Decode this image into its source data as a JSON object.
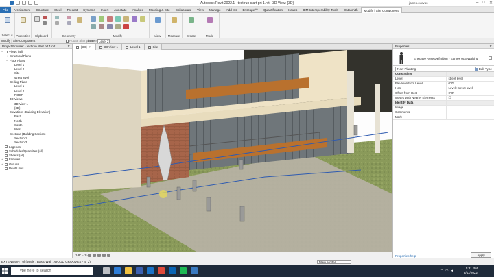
{
  "window": {
    "title": "Autodesk Revit 2022.1 - test run start prt 1.rvt - 3D View: {3D}",
    "user": "james.cuevas",
    "controls": [
      "–",
      "□",
      "✕"
    ]
  },
  "ribbon_tabs": [
    "File",
    "Architecture",
    "Structure",
    "Steel",
    "Precast",
    "Systems",
    "Insert",
    "Annotate",
    "Analyze",
    "Massing & Site",
    "Collaborate",
    "View",
    "Manage",
    "Add-Ins",
    "Enscape™",
    "Quantification",
    "Issues",
    "BIM Interoperability Tools",
    "Datasmith",
    "Modify | Site Component"
  ],
  "ribbon_groups": [
    "Select ▾",
    "Properties",
    "Clipboard",
    "Geometry",
    "Modify",
    "View",
    "Measure",
    "Create",
    "Mode"
  ],
  "options_bar": {
    "context": "Modify | Site Component",
    "rotate_label": "Rotate after placement",
    "level_label": "Level",
    "level_value": "Level 2"
  },
  "project_browser": {
    "header": "Project Browser - test run start prt 1.rvt",
    "close": "✕",
    "items": [
      {
        "label": "Views (all)",
        "toggle": "−",
        "indent": 0,
        "box": true
      },
      {
        "label": "Structural Plans",
        "toggle": "+",
        "indent": 1,
        "box": false
      },
      {
        "label": "Floor Plans",
        "toggle": "−",
        "indent": 1,
        "box": false
      },
      {
        "label": "Level 1",
        "toggle": "",
        "indent": 2,
        "box": false
      },
      {
        "label": "Level 2",
        "toggle": "",
        "indent": 2,
        "box": false
      },
      {
        "label": "Site",
        "toggle": "",
        "indent": 2,
        "box": false
      },
      {
        "label": "street level",
        "toggle": "",
        "indent": 2,
        "box": false
      },
      {
        "label": "Ceiling Plans",
        "toggle": "−",
        "indent": 1,
        "box": false
      },
      {
        "label": "Level 1",
        "toggle": "",
        "indent": 2,
        "box": false
      },
      {
        "label": "Level 2",
        "toggle": "",
        "indent": 2,
        "box": false
      },
      {
        "label": "ROOF",
        "toggle": "",
        "indent": 2,
        "box": false
      },
      {
        "label": "3D Views",
        "toggle": "−",
        "indent": 1,
        "box": false
      },
      {
        "label": "3D View 1",
        "toggle": "",
        "indent": 2,
        "box": false
      },
      {
        "label": "{3D}",
        "toggle": "",
        "indent": 2,
        "box": false
      },
      {
        "label": "Elevations (Building Elevation)",
        "toggle": "−",
        "indent": 1,
        "box": false
      },
      {
        "label": "East",
        "toggle": "",
        "indent": 2,
        "box": false
      },
      {
        "label": "North",
        "toggle": "",
        "indent": 2,
        "box": false
      },
      {
        "label": "South",
        "toggle": "",
        "indent": 2,
        "box": false
      },
      {
        "label": "West",
        "toggle": "",
        "indent": 2,
        "box": false
      },
      {
        "label": "Sections (Building Section)",
        "toggle": "−",
        "indent": 1,
        "box": false
      },
      {
        "label": "Section 1",
        "toggle": "",
        "indent": 2,
        "box": false
      },
      {
        "label": "Section 2",
        "toggle": "",
        "indent": 2,
        "box": false
      },
      {
        "label": "Legends",
        "toggle": "",
        "indent": 0,
        "box": true
      },
      {
        "label": "Schedules/Quantities (all)",
        "toggle": "",
        "indent": 0,
        "box": true
      },
      {
        "label": "Sheets (all)",
        "toggle": "",
        "indent": 0,
        "box": true
      },
      {
        "label": "Families",
        "toggle": "+",
        "indent": 0,
        "box": true
      },
      {
        "label": "Groups",
        "toggle": "+",
        "indent": 0,
        "box": true
      },
      {
        "label": "Revit Links",
        "toggle": "",
        "indent": 0,
        "box": true
      }
    ]
  },
  "doc_tabs": [
    {
      "label": "{3D}",
      "active": true
    },
    {
      "label": "3D View 1",
      "active": false
    },
    {
      "label": "Level 1",
      "active": false
    },
    {
      "label": "Site",
      "active": false
    }
  ],
  "view_control": {
    "scale": "1/8\" = 1'-0\""
  },
  "properties": {
    "header": "Properties",
    "close": "✕",
    "type_name": "Enscape AssetDefinition - Eames 003 Walking",
    "filter": "New Planting",
    "edit_type": "Edit Type",
    "rows": [
      {
        "kind": "group",
        "label": "Constraints",
        "value": ""
      },
      {
        "kind": "row",
        "label": "Level",
        "value": "street level"
      },
      {
        "kind": "row",
        "label": "Elevation from Level",
        "value": "0' 0\""
      },
      {
        "kind": "row",
        "label": "Host",
        "value": "Level : street level"
      },
      {
        "kind": "row",
        "label": "Offset from Host",
        "value": "0' 0\""
      },
      {
        "kind": "row",
        "label": "Moves With Nearby Elements",
        "value": "☐"
      },
      {
        "kind": "group",
        "label": "Identity Data",
        "value": ""
      },
      {
        "kind": "row",
        "label": "Image",
        "value": ""
      },
      {
        "kind": "row",
        "label": "Comments",
        "value": ""
      },
      {
        "kind": "row",
        "label": "Mark",
        "value": ""
      }
    ],
    "help_link": "Properties help",
    "apply": "Apply"
  },
  "status_bar": {
    "text": "EXTENSION : of (Walls : Basic Wall : WOOD GROOVES - 4\" 2)",
    "model": "Main Model"
  },
  "taskbar": {
    "search_placeholder": "Type here to search",
    "time": "5:31 PM",
    "date": "3/11/2022"
  }
}
